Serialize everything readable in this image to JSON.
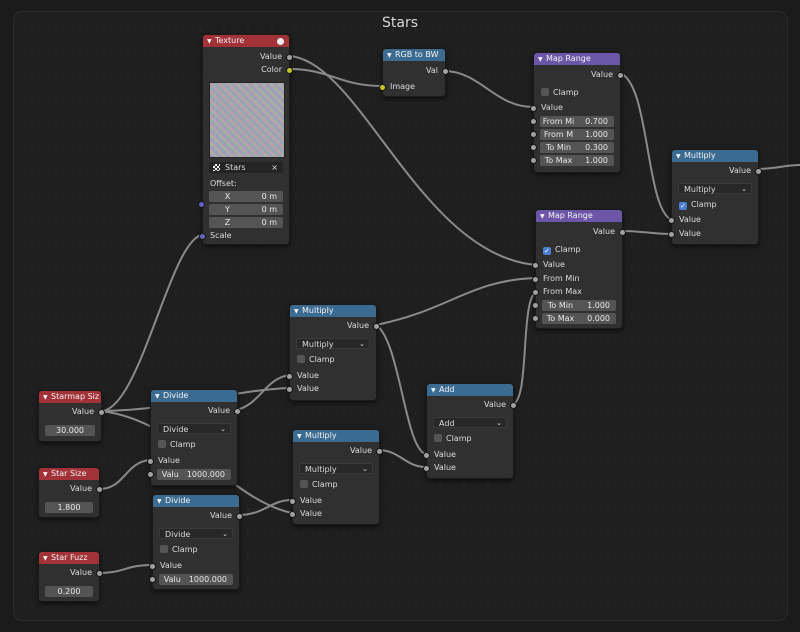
{
  "frame_title": "Stars",
  "texture": {
    "title": "Texture",
    "out_value": "Value",
    "out_color": "Color",
    "image_name": "Stars",
    "close_glyph": "×",
    "offset_label": "Offset:",
    "x_label": "X",
    "x_value": "0 m",
    "y_label": "Y",
    "y_value": "0 m",
    "z_label": "Z",
    "z_value": "0 m",
    "scale_label": "Scale"
  },
  "rgb_to_bw": {
    "title": "RGB to BW",
    "out_val": "Val",
    "in_image": "Image"
  },
  "map_range_1": {
    "title": "Map Range",
    "out_value": "Value",
    "clamp_label": "Clamp",
    "clamp_checked": false,
    "in_value": "Value",
    "from_min_label": "From Mi",
    "from_min_value": "0.700",
    "from_max_label": "From M",
    "from_max_value": "1.000",
    "to_min_label": "To Min",
    "to_min_value": "0.300",
    "to_max_label": "To Max",
    "to_max_value": "1.000"
  },
  "map_range_2": {
    "title": "Map Range",
    "out_value": "Value",
    "clamp_label": "Clamp",
    "clamp_checked": true,
    "in_value": "Value",
    "in_from_min": "From Min",
    "in_from_max": "From Max",
    "to_min_label": "To Min",
    "to_min_value": "1.000",
    "to_max_label": "To Max",
    "to_max_value": "0.000"
  },
  "multiply_right": {
    "title": "Multiply",
    "out_value": "Value",
    "op": "Multiply",
    "clamp_label": "Clamp",
    "clamp_checked": true,
    "in_a": "Value",
    "in_b": "Value"
  },
  "multiply_mid": {
    "title": "Multiply",
    "out_value": "Value",
    "op": "Multiply",
    "clamp_label": "Clamp",
    "clamp_checked": false,
    "in_a": "Value",
    "in_b": "Value"
  },
  "multiply_low": {
    "title": "Multiply",
    "out_value": "Value",
    "op": "Multiply",
    "clamp_label": "Clamp",
    "clamp_checked": false,
    "in_a": "Value",
    "in_b": "Value"
  },
  "add": {
    "title": "Add",
    "out_value": "Value",
    "op": "Add",
    "clamp_label": "Clamp",
    "clamp_checked": false,
    "in_a": "Value",
    "in_b": "Value"
  },
  "divide_1": {
    "title": "Divide",
    "out_value": "Value",
    "op": "Divide",
    "clamp_label": "Clamp",
    "clamp_checked": false,
    "in_a": "Value",
    "field_label": "Valu",
    "field_value": "1000.000"
  },
  "divide_2": {
    "title": "Divide",
    "out_value": "Value",
    "op": "Divide",
    "clamp_label": "Clamp",
    "clamp_checked": false,
    "in_a": "Value",
    "field_label": "Valu",
    "field_value": "1000.000"
  },
  "starmap_size": {
    "title": "Starmap Siz",
    "out_value": "Value",
    "value": "30.000"
  },
  "star_size": {
    "title": "Star Size",
    "out_value": "Value",
    "value": "1.800"
  },
  "star_fuzz": {
    "title": "Star Fuzz",
    "out_value": "Value",
    "value": "0.200"
  },
  "glyphs": {
    "collapse": "▼",
    "chevron": "⌄",
    "check": "✓"
  },
  "colors": {
    "input_header": "#a23238",
    "math_header": "#3c6b91",
    "converter_header": "#6c56a8",
    "float_socket": "#a1a1a1",
    "color_socket": "#c7c729",
    "vector_socket": "#6363c7"
  }
}
